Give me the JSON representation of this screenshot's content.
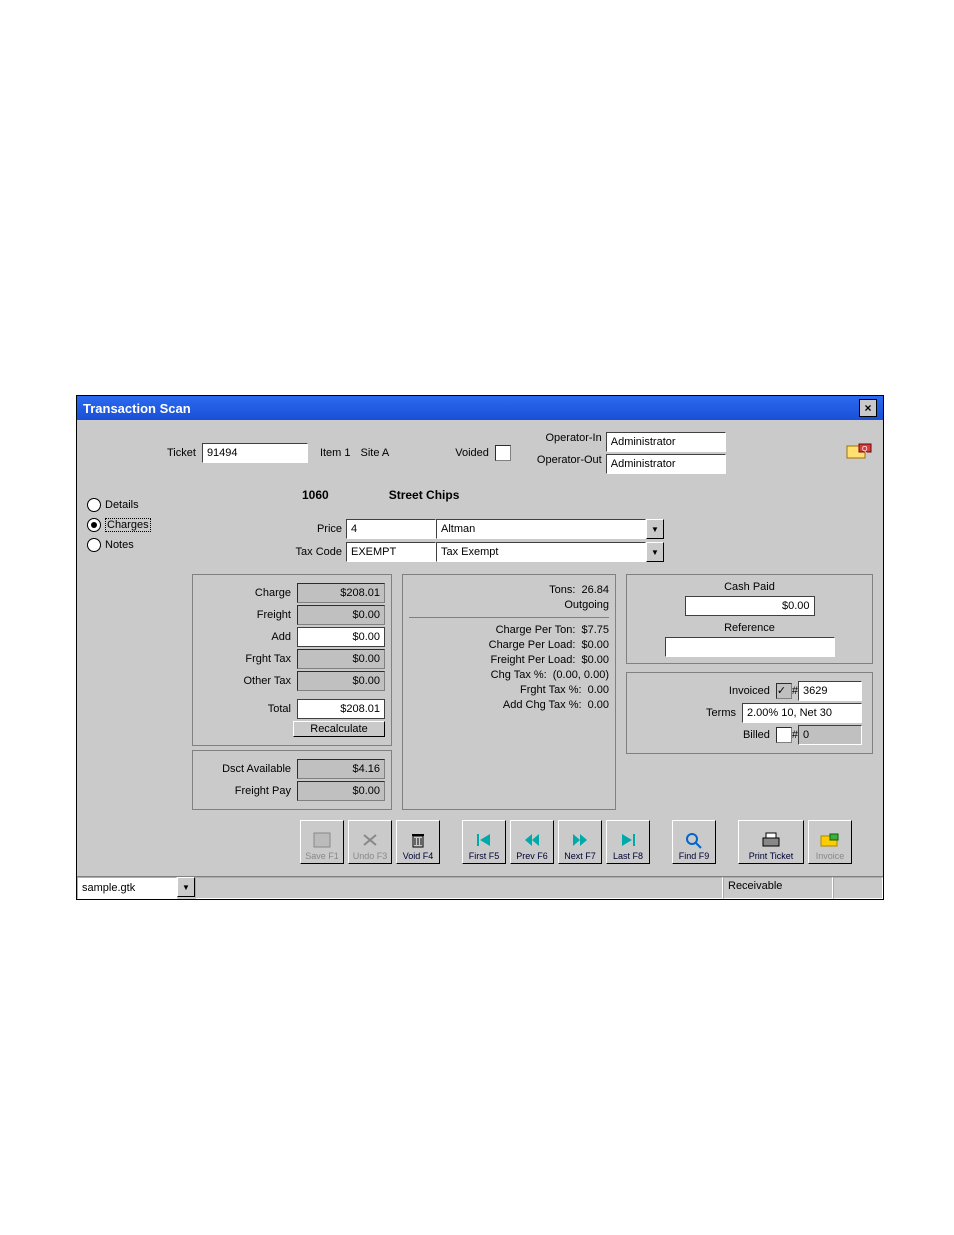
{
  "title": "Transaction Scan",
  "top": {
    "ticket_label": "Ticket",
    "ticket": "91494",
    "item_label": "Item 1",
    "site_label": "Site A",
    "voided_label": "Voided",
    "op_in_label": "Operator-In",
    "op_in": "Administrator",
    "op_out_label": "Operator-Out",
    "op_out": "Administrator"
  },
  "nav": {
    "details": "Details",
    "charges": "Charges",
    "notes": "Notes"
  },
  "header": {
    "code": "1060",
    "name": "Street  Chips"
  },
  "form": {
    "price_label": "Price",
    "price_code": "4",
    "price_name": "Altman",
    "taxcode_label": "Tax Code",
    "taxcode": "EXEMPT",
    "taxcode_name": "Tax Exempt"
  },
  "charges": {
    "charge_l": "Charge",
    "charge": "$208.01",
    "freight_l": "Freight",
    "freight": "$0.00",
    "add_l": "Add",
    "add": "$0.00",
    "frghttax_l": "Frght Tax",
    "frghttax": "$0.00",
    "othertax_l": "Other Tax",
    "othertax": "$0.00",
    "total_l": "Total",
    "total": "$208.01",
    "recalc": "Recalculate",
    "dsct_l": "Dsct Available",
    "dsct": "$4.16",
    "fpay_l": "Freight Pay",
    "fpay": "$0.00"
  },
  "mid": {
    "tons_l": "Tons:",
    "tons": "26.84",
    "direction": "Outgoing",
    "cpt_l": "Charge Per Ton:",
    "cpt": "$7.75",
    "cpl_l": "Charge Per Load:",
    "cpl": "$0.00",
    "fpl_l": "Freight Per Load:",
    "fpl": "$0.00",
    "chgtax_l": "Chg Tax %:",
    "chgtax": "(0.00, 0.00)",
    "frtax_l": "Frght Tax %:",
    "frtax": "0.00",
    "addtax_l": "Add Chg Tax %:",
    "addtax": "0.00"
  },
  "right": {
    "cash_l": "Cash Paid",
    "cash": "$0.00",
    "ref_l": "Reference",
    "ref": "",
    "inv_l": "Invoiced",
    "inv_num": "3629",
    "terms_l": "Terms",
    "terms": "2.00% 10, Net 30",
    "billed_l": "Billed",
    "billed_num": "0"
  },
  "tb": {
    "save": "Save F1",
    "undo": "Undo F3",
    "void": "Void F4",
    "first": "First F5",
    "prev": "Prev F6",
    "next": "Next F7",
    "last": "Last F8",
    "find": "Find F9",
    "print": "Print Ticket",
    "invoice": "Invoice"
  },
  "status": {
    "file": "sample.gtk",
    "receivable": "Receivable"
  }
}
